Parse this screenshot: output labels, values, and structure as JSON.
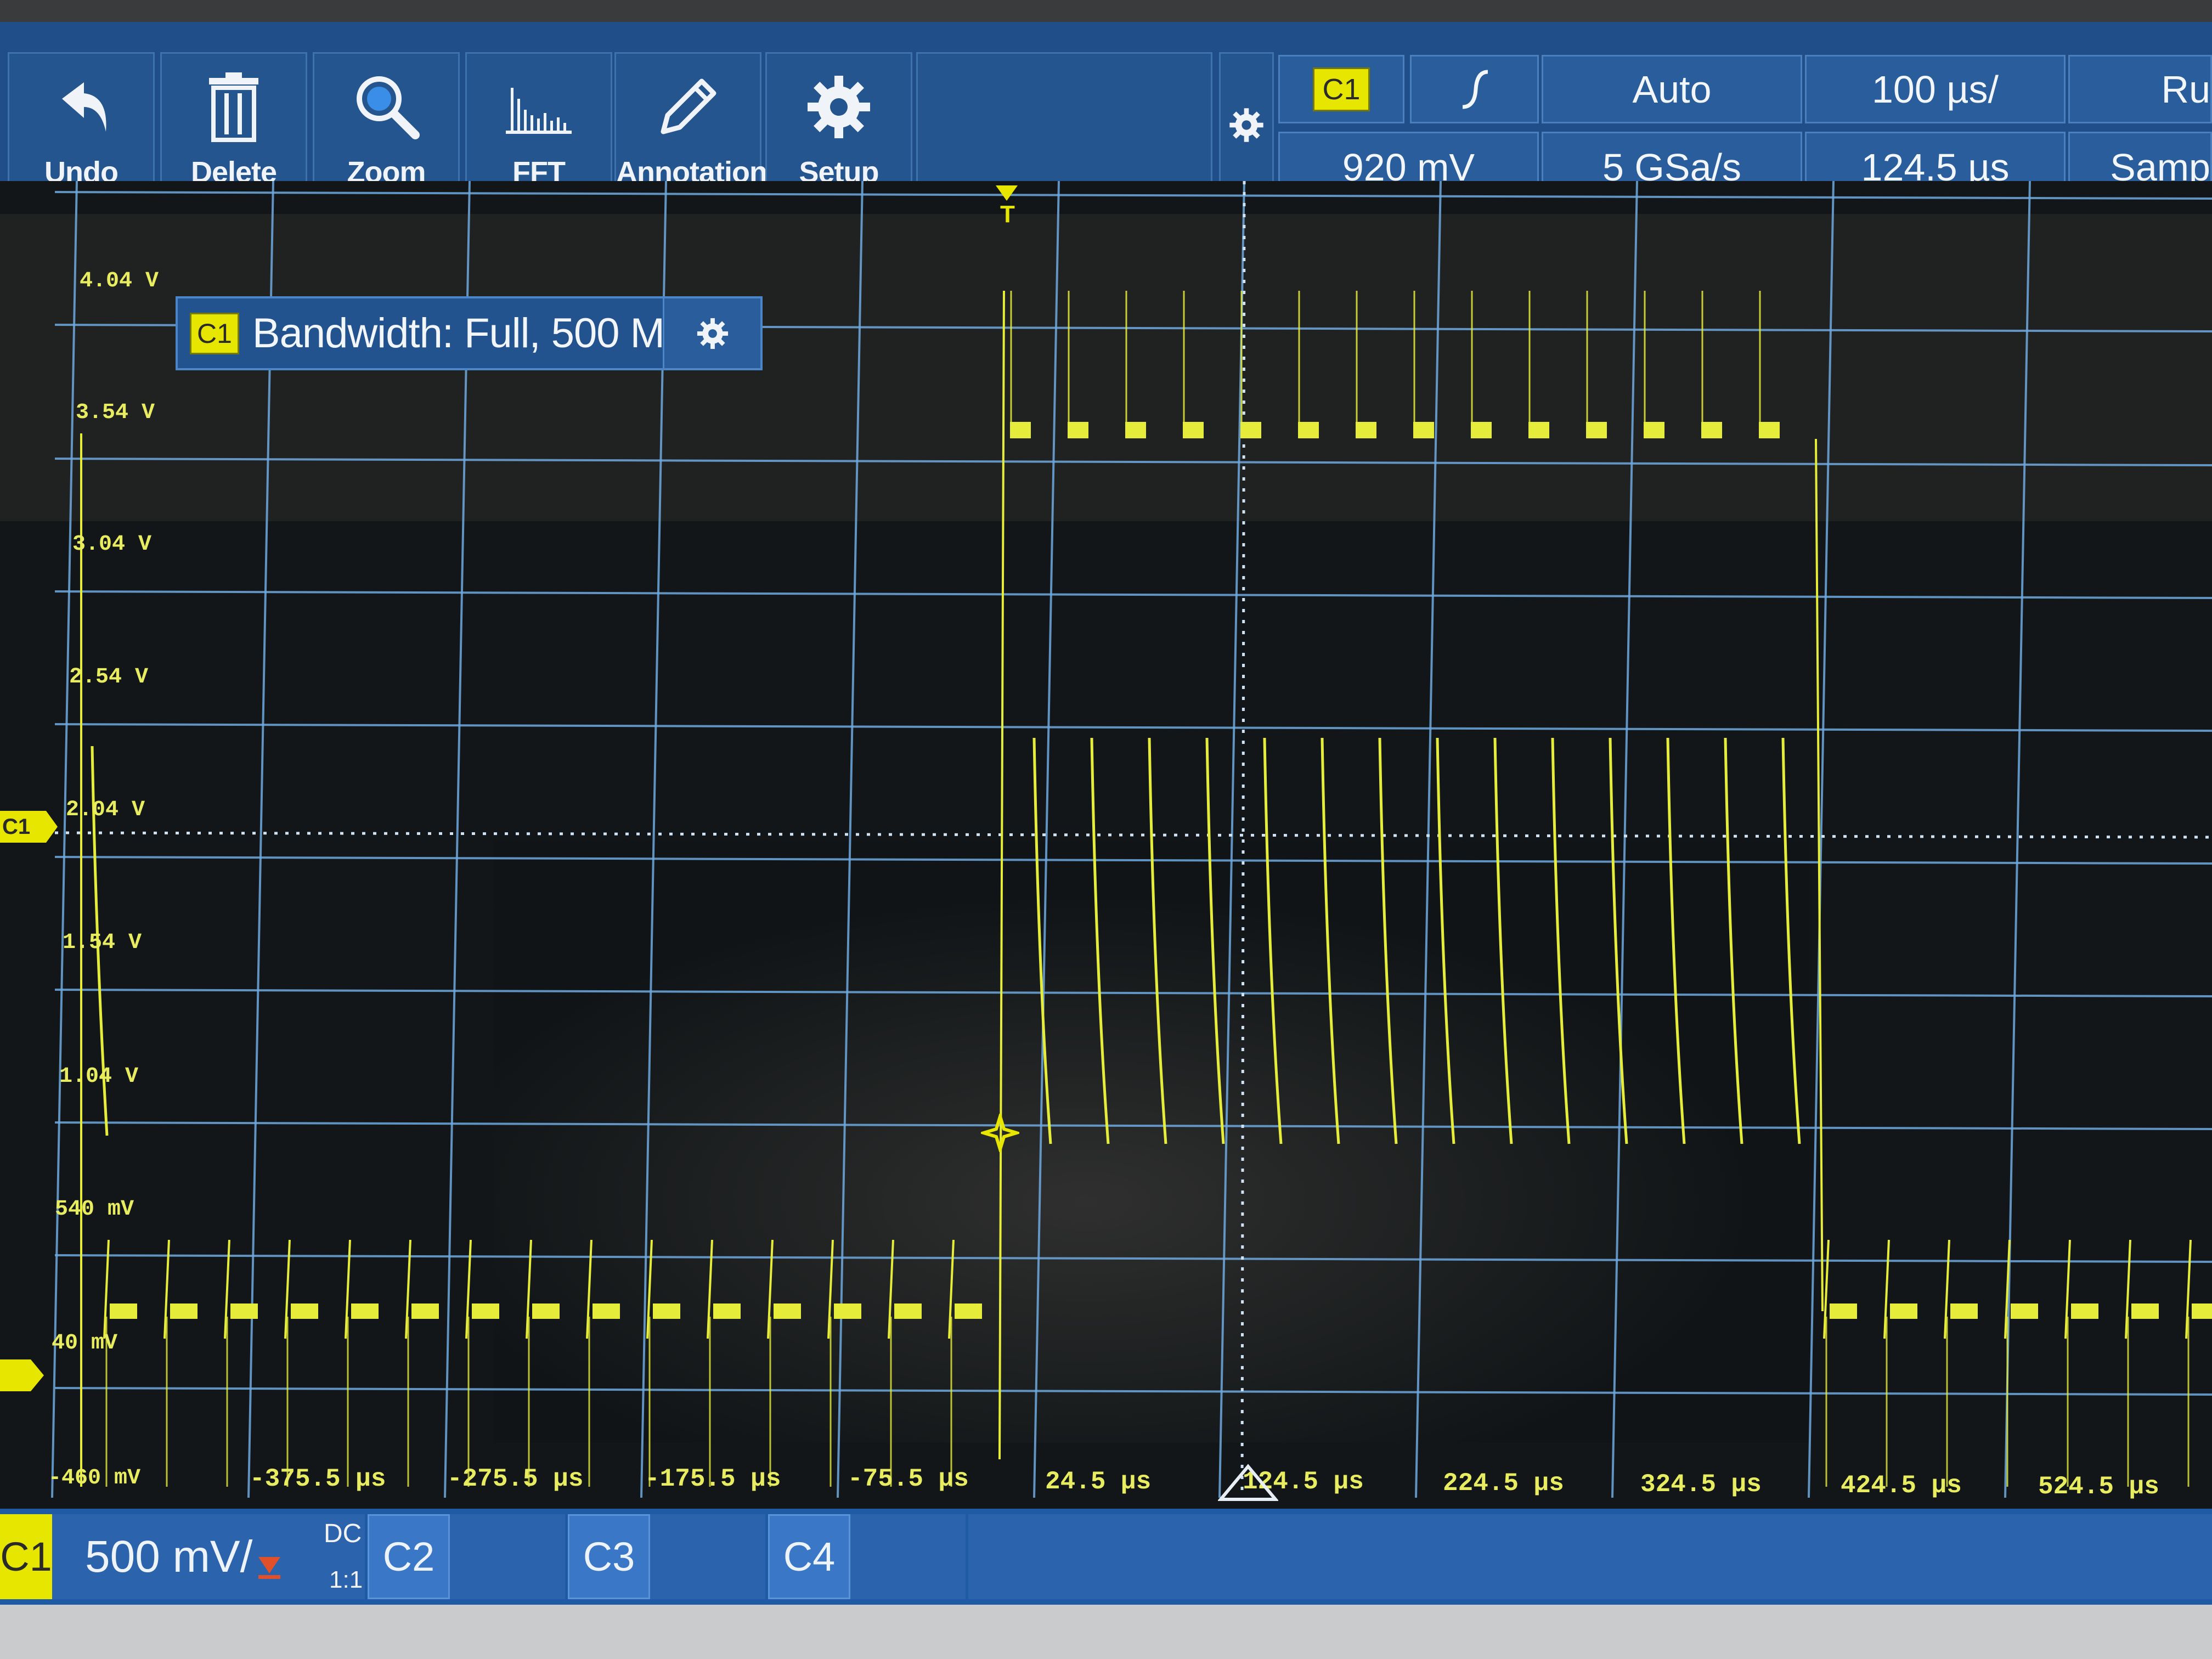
{
  "toolbar": {
    "undo": "Undo",
    "delete": "Delete",
    "zoom": "Zoom",
    "fft": "FFT",
    "annotation": "Annotation",
    "setup": "Setup"
  },
  "status_bar": {
    "trigger_source": "C1",
    "trigger_edge_icon": "rising-edge-icon",
    "trigger_mode": "Auto",
    "time_scale": "100 µs/",
    "run_state": "Ru",
    "trigger_level": "920 mV",
    "sample_rate": "5 GSa/s",
    "time_position": "124.5 µs",
    "acq_mode": "Samp"
  },
  "bandwidth_popup": {
    "channel": "C1",
    "text": "Bandwidth: Full, 500 M..."
  },
  "axis": {
    "voltage_labels": [
      "4.04 V",
      "3.54 V",
      "3.04 V",
      "2.54 V",
      "2.04 V",
      "1.54 V",
      "1.04 V",
      "540 mV",
      "40 mV",
      "-460 mV"
    ],
    "time_labels": [
      "-375.5 µs",
      "-275.5 µs",
      "-175.5 µs",
      "-75.5 µs",
      "24.5 µs",
      "124.5 µs",
      "224.5 µs",
      "324.5 µs",
      "424.5 µs",
      "524.5 µs"
    ]
  },
  "markers": {
    "channel_marker": "C1",
    "trigger_marker": "T"
  },
  "channel_bar": {
    "c1_label": "C1",
    "c1_scale": "500 mV/",
    "c1_coupling": "DC",
    "c1_ratio": "1:1",
    "c2_label": "C2",
    "c3_label": "C3",
    "c4_label": "C4"
  },
  "colors": {
    "toolbar_bg": "#1f4e89",
    "trace": "#e6ec3a",
    "grid": "#6fa9df",
    "chip": "#e6e600"
  }
}
